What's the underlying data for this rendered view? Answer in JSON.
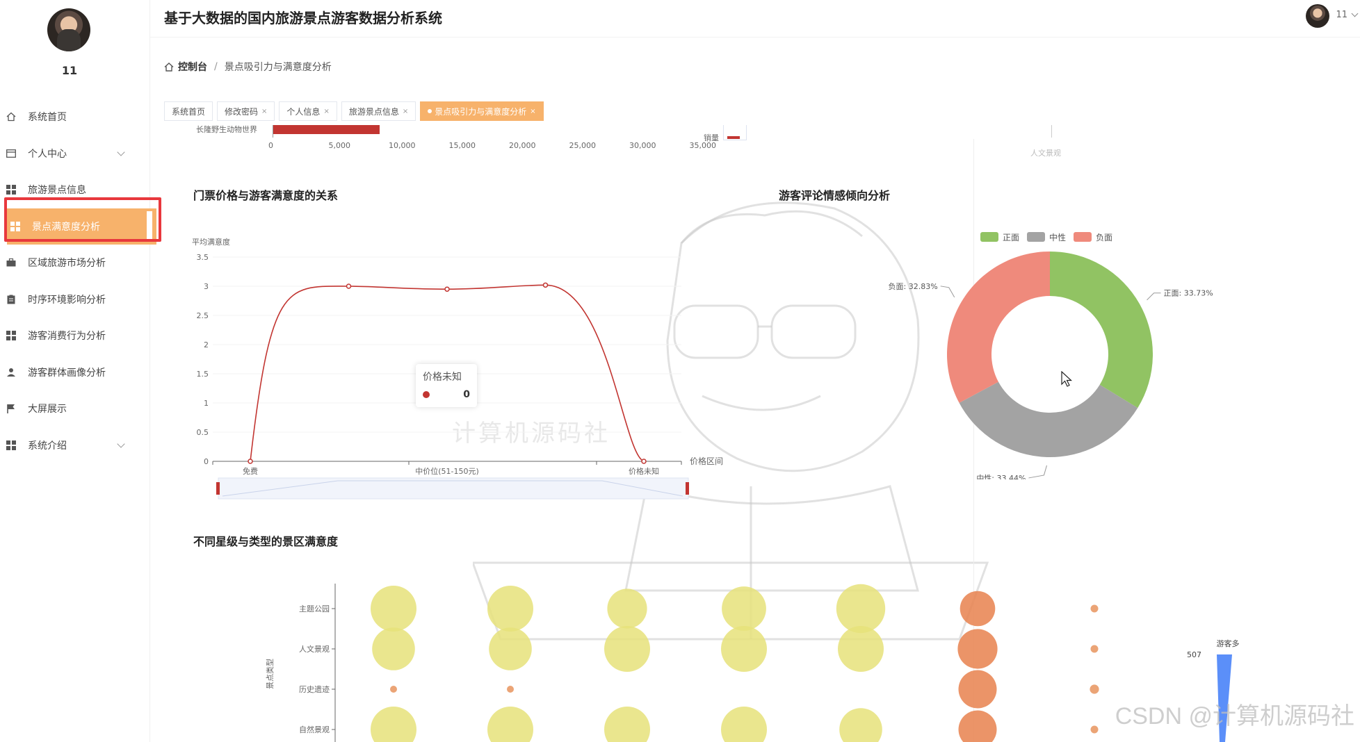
{
  "app": {
    "title": "基于大数据的国内旅游景点游客数据分析系统",
    "user": "11"
  },
  "sidebar": {
    "username": "11",
    "items": [
      {
        "label": "系统首页",
        "icon": "home-icon"
      },
      {
        "label": "个人中心",
        "icon": "card-icon"
      },
      {
        "label": "旅游景点信息",
        "icon": "grid-icon"
      },
      {
        "label": "景点满意度分析",
        "icon": "grid-icon"
      },
      {
        "label": "区域旅游市场分析",
        "icon": "briefcase-icon"
      },
      {
        "label": "时序环境影响分析",
        "icon": "clipboard-icon"
      },
      {
        "label": "游客消费行为分析",
        "icon": "grid-icon"
      },
      {
        "label": "游客群体画像分析",
        "icon": "user-icon"
      },
      {
        "label": "大屏展示",
        "icon": "flag-icon"
      },
      {
        "label": "系统介绍",
        "icon": "grid-icon"
      }
    ]
  },
  "breadcrumb": {
    "home": "控制台",
    "separator": "/",
    "current": "景点吸引力与满意度分析"
  },
  "tabs": [
    {
      "label": "系统首页",
      "closable": false
    },
    {
      "label": "修改密码",
      "closable": true
    },
    {
      "label": "个人信息",
      "closable": true
    },
    {
      "label": "旅游景点信息",
      "closable": true
    },
    {
      "label": "景点吸引力与满意度分析",
      "closable": true
    }
  ],
  "top_partial": {
    "bar_label": "长隆野生动物世界",
    "axis_ticks": [
      "0",
      "5,000",
      "10,000",
      "15,000",
      "20,000",
      "25,000",
      "30,000",
      "35,000"
    ],
    "sales_label": "销量",
    "right_label": "人文景观"
  },
  "charts": {
    "price_title": "门票价格与游客满意度的关系",
    "sentiment_title": "游客评论情感倾向分析",
    "star_title": "不同星级与类型的景区满意度"
  },
  "tooltip": {
    "title": "价格未知",
    "value": "0"
  },
  "chart_data": [
    {
      "type": "line",
      "title": "门票价格与游客满意度的关系",
      "ylabel": "平均满意度",
      "xlabel": "价格区间",
      "x_visible_labels": [
        "免费",
        "中价位(51-150元)",
        "价格未知"
      ],
      "points": [
        0,
        3.0,
        2.95,
        3.02,
        0
      ],
      "ylim": [
        0,
        3.5
      ],
      "y_ticks": [
        "0",
        "0.5",
        "1",
        "1.5",
        "2",
        "2.5",
        "3",
        "3.5"
      ],
      "color": "#c23531"
    },
    {
      "type": "pie",
      "title": "游客评论情感倾向分析",
      "legend": [
        "正面",
        "中性",
        "负面"
      ],
      "legend_position": "top",
      "slices": [
        {
          "name": "正面",
          "value": 33.73,
          "label": "正面: 33.73%",
          "color": "#91c363"
        },
        {
          "name": "中性",
          "value": 33.44,
          "label": "中性: 33.44%",
          "color": "#a3a3a3"
        },
        {
          "name": "负面",
          "value": 32.83,
          "label": "负面: 32.83%",
          "color": "#ef8a7c"
        }
      ]
    },
    {
      "type": "scatter",
      "title": "不同星级与类型的景区满意度",
      "ylabel": "景点类型",
      "categories_y": [
        "主题公园",
        "人文景观",
        "历史遗迹",
        "自然景观"
      ],
      "columns": 7,
      "bubbles": [
        {
          "col": 0,
          "row": 0,
          "size": 3,
          "color": "#e6e27a"
        },
        {
          "col": 0,
          "row": 1,
          "size": 2.8,
          "color": "#e6e27a"
        },
        {
          "col": 0,
          "row": 2,
          "size": 0.4,
          "color": "#e8945e"
        },
        {
          "col": 0,
          "row": 3,
          "size": 3,
          "color": "#e6e27a"
        },
        {
          "col": 1,
          "row": 0,
          "size": 3,
          "color": "#e6e27a"
        },
        {
          "col": 1,
          "row": 1,
          "size": 2.8,
          "color": "#e6e27a"
        },
        {
          "col": 1,
          "row": 2,
          "size": 0.4,
          "color": "#e8945e"
        },
        {
          "col": 1,
          "row": 3,
          "size": 3,
          "color": "#e6e27a"
        },
        {
          "col": 2,
          "row": 0,
          "size": 2.6,
          "color": "#e6e27a"
        },
        {
          "col": 2,
          "row": 1,
          "size": 3,
          "color": "#e6e27a"
        },
        {
          "col": 2,
          "row": 3,
          "size": 3,
          "color": "#e6e27a"
        },
        {
          "col": 3,
          "row": 0,
          "size": 2.9,
          "color": "#e6e27a"
        },
        {
          "col": 3,
          "row": 1,
          "size": 3,
          "color": "#e6e27a"
        },
        {
          "col": 3,
          "row": 3,
          "size": 3,
          "color": "#e6e27a"
        },
        {
          "col": 4,
          "row": 0,
          "size": 3.2,
          "color": "#e6e27a"
        },
        {
          "col": 4,
          "row": 1,
          "size": 3,
          "color": "#e6e27a"
        },
        {
          "col": 4,
          "row": 3,
          "size": 2.8,
          "color": "#e6e27a"
        },
        {
          "col": 5,
          "row": 0,
          "size": 2.3,
          "color": "#e8814d"
        },
        {
          "col": 5,
          "row": 1,
          "size": 2.6,
          "color": "#e8814d"
        },
        {
          "col": 5,
          "row": 2,
          "size": 2.5,
          "color": "#e8814d"
        },
        {
          "col": 5,
          "row": 3,
          "size": 2.5,
          "color": "#e8814d"
        },
        {
          "col": 6,
          "row": 0,
          "size": 0.5,
          "color": "#e8945e"
        },
        {
          "col": 6,
          "row": 1,
          "size": 0.5,
          "color": "#e8945e"
        },
        {
          "col": 6,
          "row": 2,
          "size": 0.6,
          "color": "#e8945e"
        },
        {
          "col": 6,
          "row": 3,
          "size": 0.5,
          "color": "#e8945e"
        }
      ],
      "side_bar": {
        "label": "游客多",
        "value": "507",
        "color": "#5b8ff9"
      }
    }
  ],
  "watermarks": {
    "center": "计算机源码社",
    "corner": "CSDN @计算机源码社"
  }
}
